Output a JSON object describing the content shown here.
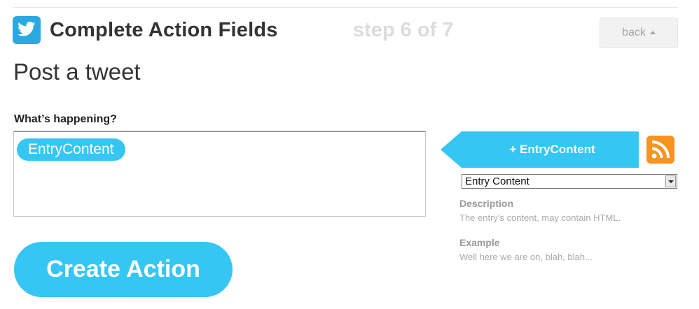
{
  "header": {
    "title": "Complete Action Fields",
    "step": "step 6 of 7",
    "back_label": "back",
    "service_icon": "twitter-bird-icon",
    "service_color": "#29a9e0"
  },
  "action": {
    "title": "Post a tweet"
  },
  "field": {
    "label": "What’s happening?",
    "tokens": [
      "EntryContent"
    ]
  },
  "ingredients": {
    "add_button_label": "+ EntryContent",
    "trigger_icon": "rss-icon",
    "trigger_color": "#f7931e",
    "selected": "Entry Content",
    "description_heading": "Description",
    "description_text": "The entry's content, may contain HTML.",
    "example_heading": "Example",
    "example_text": "Well here we are on, blah, blah..."
  },
  "submit": {
    "label": "Create Action"
  },
  "colors": {
    "accent": "#36c6f4",
    "muted": "#dcdcdc"
  }
}
